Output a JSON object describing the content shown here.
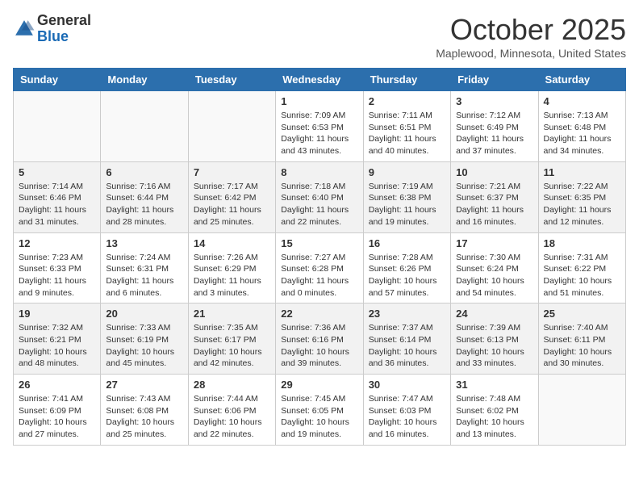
{
  "header": {
    "logo_general": "General",
    "logo_blue": "Blue",
    "month": "October 2025",
    "location": "Maplewood, Minnesota, United States"
  },
  "days_of_week": [
    "Sunday",
    "Monday",
    "Tuesday",
    "Wednesday",
    "Thursday",
    "Friday",
    "Saturday"
  ],
  "weeks": [
    [
      {
        "day": null
      },
      {
        "day": null
      },
      {
        "day": null
      },
      {
        "day": "1",
        "sunrise": "7:09 AM",
        "sunset": "6:53 PM",
        "daylight": "11 hours and 43 minutes."
      },
      {
        "day": "2",
        "sunrise": "7:11 AM",
        "sunset": "6:51 PM",
        "daylight": "11 hours and 40 minutes."
      },
      {
        "day": "3",
        "sunrise": "7:12 AM",
        "sunset": "6:49 PM",
        "daylight": "11 hours and 37 minutes."
      },
      {
        "day": "4",
        "sunrise": "7:13 AM",
        "sunset": "6:48 PM",
        "daylight": "11 hours and 34 minutes."
      }
    ],
    [
      {
        "day": "5",
        "sunrise": "7:14 AM",
        "sunset": "6:46 PM",
        "daylight": "11 hours and 31 minutes."
      },
      {
        "day": "6",
        "sunrise": "7:16 AM",
        "sunset": "6:44 PM",
        "daylight": "11 hours and 28 minutes."
      },
      {
        "day": "7",
        "sunrise": "7:17 AM",
        "sunset": "6:42 PM",
        "daylight": "11 hours and 25 minutes."
      },
      {
        "day": "8",
        "sunrise": "7:18 AM",
        "sunset": "6:40 PM",
        "daylight": "11 hours and 22 minutes."
      },
      {
        "day": "9",
        "sunrise": "7:19 AM",
        "sunset": "6:38 PM",
        "daylight": "11 hours and 19 minutes."
      },
      {
        "day": "10",
        "sunrise": "7:21 AM",
        "sunset": "6:37 PM",
        "daylight": "11 hours and 16 minutes."
      },
      {
        "day": "11",
        "sunrise": "7:22 AM",
        "sunset": "6:35 PM",
        "daylight": "11 hours and 12 minutes."
      }
    ],
    [
      {
        "day": "12",
        "sunrise": "7:23 AM",
        "sunset": "6:33 PM",
        "daylight": "11 hours and 9 minutes."
      },
      {
        "day": "13",
        "sunrise": "7:24 AM",
        "sunset": "6:31 PM",
        "daylight": "11 hours and 6 minutes."
      },
      {
        "day": "14",
        "sunrise": "7:26 AM",
        "sunset": "6:29 PM",
        "daylight": "11 hours and 3 minutes."
      },
      {
        "day": "15",
        "sunrise": "7:27 AM",
        "sunset": "6:28 PM",
        "daylight": "11 hours and 0 minutes."
      },
      {
        "day": "16",
        "sunrise": "7:28 AM",
        "sunset": "6:26 PM",
        "daylight": "10 hours and 57 minutes."
      },
      {
        "day": "17",
        "sunrise": "7:30 AM",
        "sunset": "6:24 PM",
        "daylight": "10 hours and 54 minutes."
      },
      {
        "day": "18",
        "sunrise": "7:31 AM",
        "sunset": "6:22 PM",
        "daylight": "10 hours and 51 minutes."
      }
    ],
    [
      {
        "day": "19",
        "sunrise": "7:32 AM",
        "sunset": "6:21 PM",
        "daylight": "10 hours and 48 minutes."
      },
      {
        "day": "20",
        "sunrise": "7:33 AM",
        "sunset": "6:19 PM",
        "daylight": "10 hours and 45 minutes."
      },
      {
        "day": "21",
        "sunrise": "7:35 AM",
        "sunset": "6:17 PM",
        "daylight": "10 hours and 42 minutes."
      },
      {
        "day": "22",
        "sunrise": "7:36 AM",
        "sunset": "6:16 PM",
        "daylight": "10 hours and 39 minutes."
      },
      {
        "day": "23",
        "sunrise": "7:37 AM",
        "sunset": "6:14 PM",
        "daylight": "10 hours and 36 minutes."
      },
      {
        "day": "24",
        "sunrise": "7:39 AM",
        "sunset": "6:13 PM",
        "daylight": "10 hours and 33 minutes."
      },
      {
        "day": "25",
        "sunrise": "7:40 AM",
        "sunset": "6:11 PM",
        "daylight": "10 hours and 30 minutes."
      }
    ],
    [
      {
        "day": "26",
        "sunrise": "7:41 AM",
        "sunset": "6:09 PM",
        "daylight": "10 hours and 27 minutes."
      },
      {
        "day": "27",
        "sunrise": "7:43 AM",
        "sunset": "6:08 PM",
        "daylight": "10 hours and 25 minutes."
      },
      {
        "day": "28",
        "sunrise": "7:44 AM",
        "sunset": "6:06 PM",
        "daylight": "10 hours and 22 minutes."
      },
      {
        "day": "29",
        "sunrise": "7:45 AM",
        "sunset": "6:05 PM",
        "daylight": "10 hours and 19 minutes."
      },
      {
        "day": "30",
        "sunrise": "7:47 AM",
        "sunset": "6:03 PM",
        "daylight": "10 hours and 16 minutes."
      },
      {
        "day": "31",
        "sunrise": "7:48 AM",
        "sunset": "6:02 PM",
        "daylight": "10 hours and 13 minutes."
      },
      {
        "day": null
      }
    ]
  ],
  "labels": {
    "sunrise_prefix": "Sunrise: ",
    "sunset_prefix": "Sunset: ",
    "daylight_prefix": "Daylight: "
  }
}
